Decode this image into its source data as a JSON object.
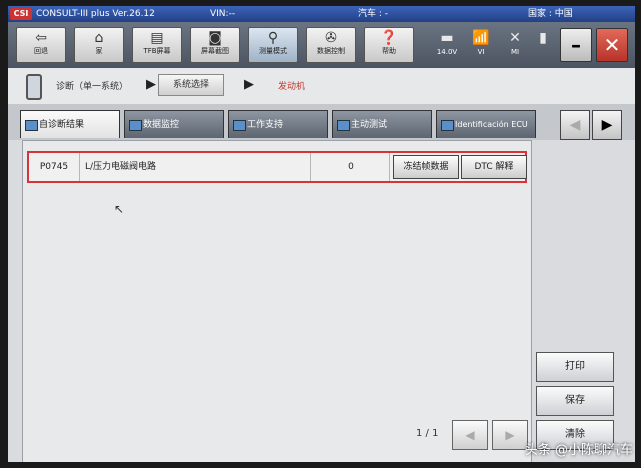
{
  "titlebar": {
    "logo": "CSI",
    "app": "CONSULT-III plus Ver.26.12",
    "vin": "VIN:--",
    "vehicle": "汽车 : -",
    "country": "国家 : 中国"
  },
  "toolbar": {
    "buttons": [
      {
        "label": "回退",
        "icon": "back-icon"
      },
      {
        "label": "家",
        "icon": "home-icon"
      },
      {
        "label": "TFB屏幕",
        "icon": "print-icon"
      },
      {
        "label": "屏幕截图",
        "icon": "camera-icon"
      },
      {
        "label": "测量模式",
        "icon": "measure-icon"
      },
      {
        "label": "数据控制",
        "icon": "recorder-icon"
      },
      {
        "label": "帮助",
        "icon": "help-icon"
      }
    ],
    "status": {
      "battery": "14.0V",
      "vi": "VI",
      "mi": "MI"
    }
  },
  "breadcrumb": {
    "step1": "诊断（单一系统）",
    "step2": "系统选择",
    "step3": "发动机"
  },
  "tabs": [
    {
      "label": "自诊断结果"
    },
    {
      "label": "数据监控"
    },
    {
      "label": "工作支持"
    },
    {
      "label": "主动测试"
    },
    {
      "label": "Identificación ECU"
    }
  ],
  "dtc": {
    "code": "P0745",
    "description": "L/压力电磁阀电路",
    "count": "0",
    "freeze_button": "冻结帧数据",
    "explain_button": "DTC 解释"
  },
  "pagination": {
    "label": "1 / 1"
  },
  "side_buttons": {
    "print": "打印",
    "save": "保存",
    "erase": "清除"
  },
  "watermark": "头条 @小陈聊汽车"
}
